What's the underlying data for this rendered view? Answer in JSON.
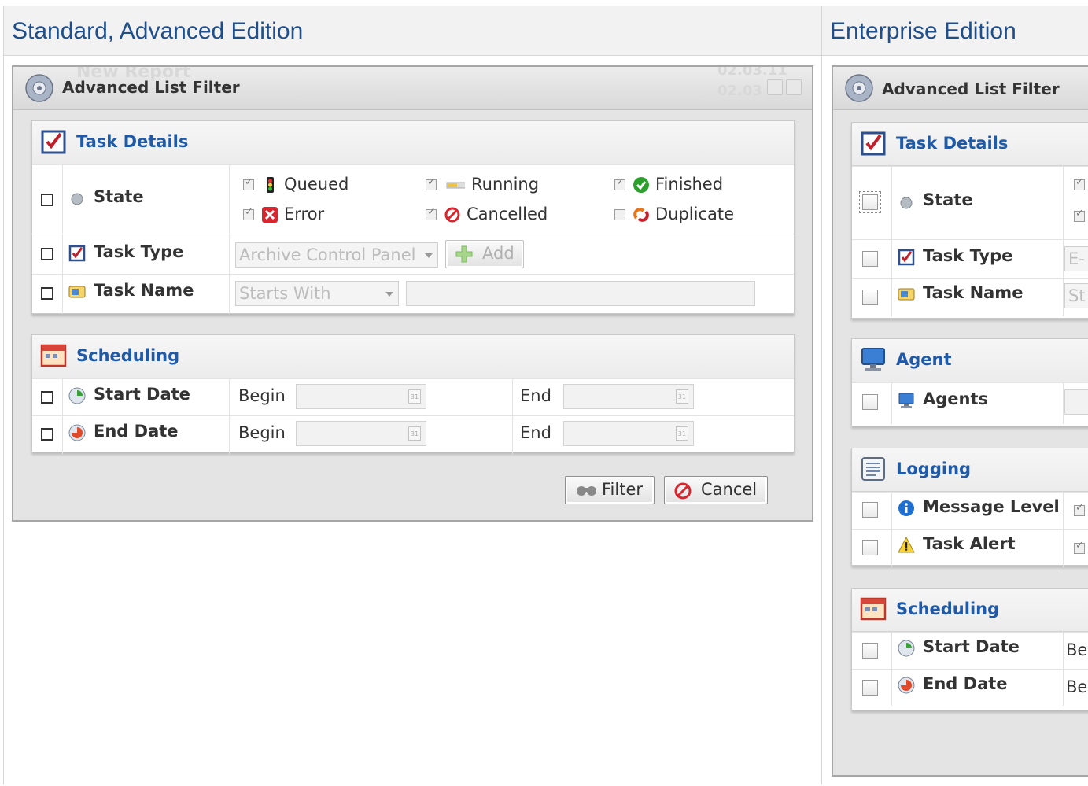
{
  "columns": {
    "left": "Standard, Advanced Edition",
    "right": "Enterprise Edition"
  },
  "left_window": {
    "title": "Advanced List Filter",
    "ghost_title": "New Report",
    "ghost_date_1": "02.03.11",
    "ghost_date_2": "02.03",
    "task_details": {
      "label": "Task Details",
      "state_label": "State",
      "states": [
        "Queued",
        "Running",
        "Finished",
        "Error",
        "Cancelled",
        "Duplicate"
      ],
      "task_type_label": "Task Type",
      "task_type_value": "Archive Control Panel",
      "add_label": "Add",
      "task_name_label": "Task Name",
      "task_name_op": "Starts With"
    },
    "scheduling": {
      "label": "Scheduling",
      "start_label": "Start Date",
      "end_label": "End Date",
      "begin": "Begin",
      "end": "End"
    },
    "filter_label": "Filter",
    "cancel_label": "Cancel"
  },
  "right_window": {
    "title": "Advanced List Filter",
    "task_details": {
      "label": "Task Details",
      "state_label": "State",
      "task_type_label": "Task Type",
      "task_type_value": "E-",
      "task_name_label": "Task Name",
      "task_name_op": "St"
    },
    "agent": {
      "label": "Agent",
      "agents_label": "Agents"
    },
    "logging": {
      "label": "Logging",
      "message_level": "Message Level",
      "task_alert": "Task Alert"
    },
    "scheduling": {
      "label": "Scheduling",
      "start_label": "Start Date",
      "end_label": "End Date",
      "begin_partial": "Be"
    }
  },
  "colors": {
    "accent": "#1f5aa8",
    "heading": "#1f4e8c"
  }
}
